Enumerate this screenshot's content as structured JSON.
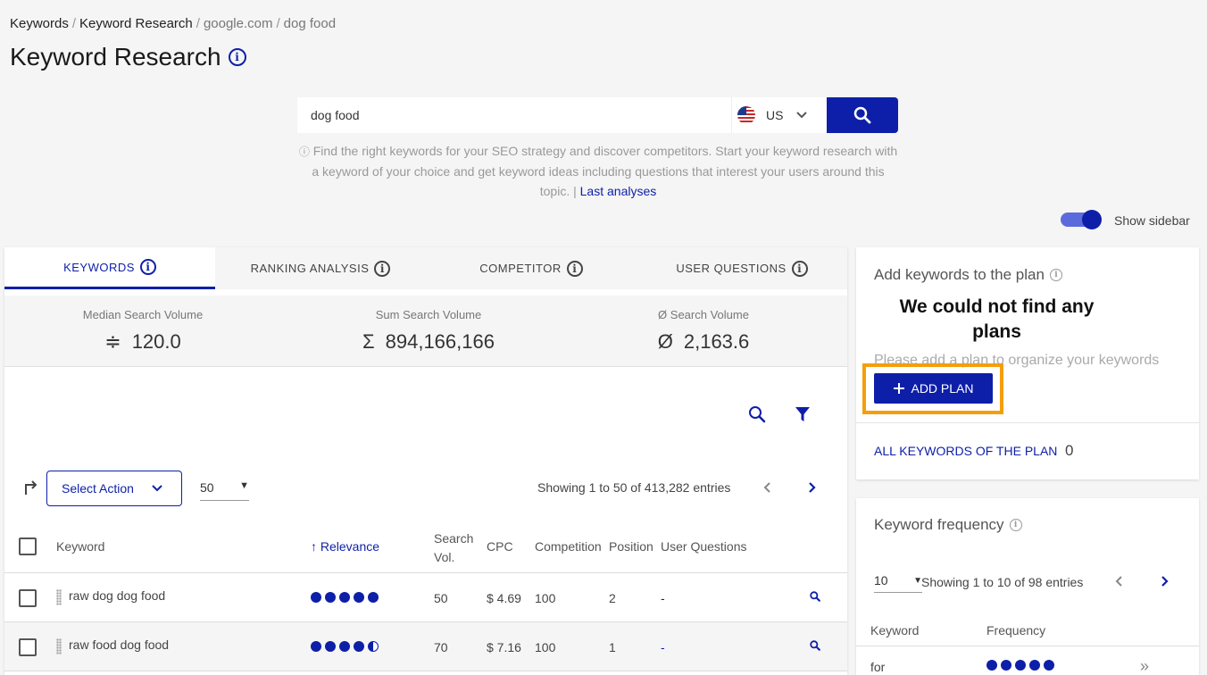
{
  "breadcrumb": {
    "items": [
      "Keywords",
      "Keyword Research",
      "google.com",
      "dog food"
    ],
    "separator": "/"
  },
  "page_title": "Keyword Research",
  "search": {
    "value": "dog food",
    "country": "US",
    "hint": "Find the right keywords for your SEO strategy and discover competitors. Start your keyword research with a keyword of your choice and get keyword ideas including questions that interest your users around this topic.",
    "pipe": "|",
    "last_analyses": "Last analyses"
  },
  "show_sidebar": {
    "label": "Show sidebar",
    "on": true
  },
  "tabs": [
    {
      "label": "KEYWORDS",
      "active": true
    },
    {
      "label": "RANKING ANALYSIS",
      "active": false
    },
    {
      "label": "COMPETITOR",
      "active": false
    },
    {
      "label": "USER QUESTIONS",
      "active": false
    }
  ],
  "stats": [
    {
      "label": "Median Search Volume",
      "symbol": "≑",
      "value": "120.0"
    },
    {
      "label": "Sum Search Volume",
      "symbol": "Σ",
      "value": "894,166,166"
    },
    {
      "label": "Ø Search Volume",
      "symbol": "Ø",
      "value": "2,163.6"
    }
  ],
  "toolbar": {
    "select_action": "Select Action",
    "per_page": "50",
    "showing": "Showing 1 to 50 of 413,282 entries"
  },
  "table": {
    "headers": {
      "keyword": "Keyword",
      "relevance": "Relevance",
      "search_vol_1": "Search",
      "search_vol_2": "Vol.",
      "cpc": "CPC",
      "competition": "Competition",
      "position": "Position",
      "user_questions": "User Questions"
    },
    "rows": [
      {
        "keyword": "raw dog dog food",
        "relevance": 5,
        "search_vol": "50",
        "cpc": "$ 4.69",
        "competition": "100",
        "position": "2",
        "user_questions": "-"
      },
      {
        "keyword": "raw food dog food",
        "relevance": 4.5,
        "search_vol": "70",
        "cpc": "$ 7.16",
        "competition": "100",
        "position": "1",
        "user_questions": "-"
      }
    ]
  },
  "plan": {
    "title": "Add keywords to the plan",
    "not_found": "We could not find any plans",
    "please": "Please add a plan to organize your keywords",
    "add_plan": "ADD PLAN",
    "all_keywords": "ALL KEYWORDS OF THE PLAN",
    "all_keywords_count": "0"
  },
  "frequency": {
    "title": "Keyword frequency",
    "per_page": "10",
    "showing": "Showing 1 to 10 of 98 entries",
    "col_keyword": "Keyword",
    "col_frequency": "Frequency",
    "rows": [
      {
        "keyword": "for",
        "frequency": 5
      }
    ]
  },
  "colors": {
    "accent": "#0d1fa8",
    "highlight": "#f59e0b"
  }
}
